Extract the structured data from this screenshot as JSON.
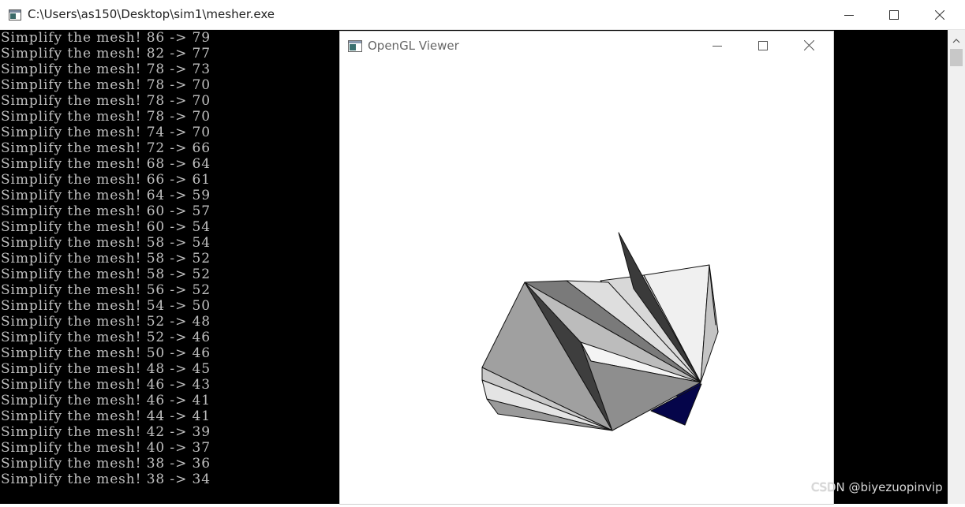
{
  "console": {
    "title": "C:\\Users\\as150\\Desktop\\sim1\\mesher.exe",
    "lines": [
      "Simplify the mesh! 86 -> 79",
      "Simplify the mesh! 82 -> 77",
      "Simplify the mesh! 78 -> 73",
      "Simplify the mesh! 78 -> 70",
      "Simplify the mesh! 78 -> 70",
      "Simplify the mesh! 78 -> 70",
      "Simplify the mesh! 74 -> 70",
      "Simplify the mesh! 72 -> 66",
      "Simplify the mesh! 68 -> 64",
      "Simplify the mesh! 66 -> 61",
      "Simplify the mesh! 64 -> 59",
      "Simplify the mesh! 60 -> 57",
      "Simplify the mesh! 60 -> 54",
      "Simplify the mesh! 58 -> 54",
      "Simplify the mesh! 58 -> 52",
      "Simplify the mesh! 58 -> 52",
      "Simplify the mesh! 56 -> 52",
      "Simplify the mesh! 54 -> 50",
      "Simplify the mesh! 52 -> 48",
      "Simplify the mesh! 52 -> 46",
      "Simplify the mesh! 50 -> 46",
      "Simplify the mesh! 48 -> 45",
      "Simplify the mesh! 46 -> 43",
      "Simplify the mesh! 46 -> 41",
      "Simplify the mesh! 44 -> 41",
      "Simplify the mesh! 42 -> 39",
      "Simplify the mesh! 40 -> 37",
      "Simplify the mesh! 38 -> 36",
      "Simplify the mesh! 38 -> 34"
    ],
    "text_color": "#c0c0c0",
    "background": "#000000"
  },
  "viewer": {
    "title": "OpenGL Viewer",
    "background": "#ffffff",
    "mesh_colors": {
      "light": "#f0f0f0",
      "mid_light": "#d4d4d4",
      "mid": "#a8a8a8",
      "mid_dark": "#8c8c8c",
      "dark": "#3a3a3a",
      "accent": "#0a0a6e"
    }
  },
  "watermark": "CSDN @biyezuopinvip",
  "icons": {
    "console_app": "console-app-icon",
    "viewer_app": "viewer-app-icon",
    "minimize": "minimize-icon",
    "maximize": "maximize-icon",
    "close": "close-icon",
    "scroll_up": "scroll-up-arrow-icon"
  }
}
